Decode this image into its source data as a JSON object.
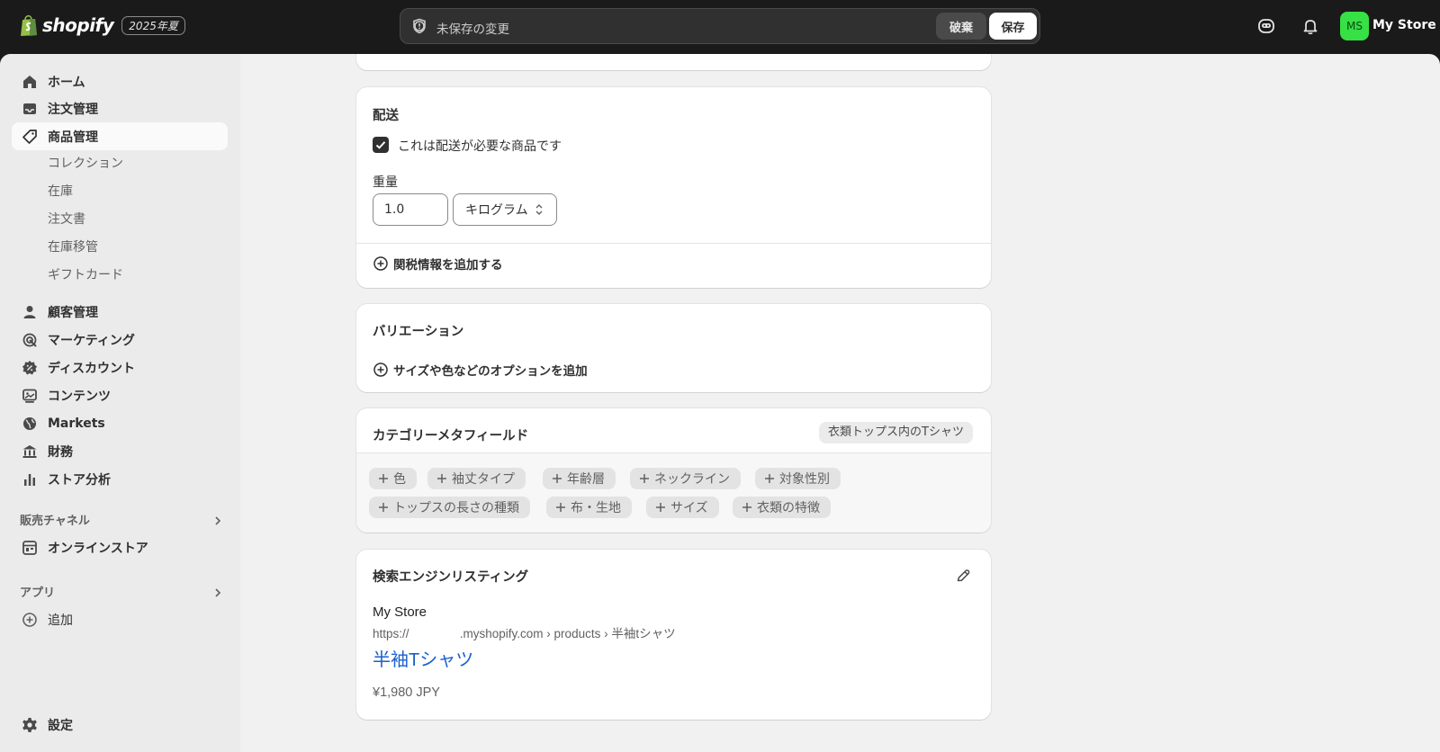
{
  "header": {
    "logo_text": "shopify",
    "edition_badge": "2025年夏",
    "unsaved_text": "未保存の変更",
    "discard_label": "破棄",
    "save_label": "保存",
    "store_initials": "MS",
    "store_name": "My Store",
    "avatar_color": "#36e045"
  },
  "sidebar": {
    "items": [
      {
        "label": "ホーム",
        "icon": "home-icon"
      },
      {
        "label": "注文管理",
        "icon": "inbox-icon"
      },
      {
        "label": "商品管理",
        "icon": "tag-icon",
        "active": true
      }
    ],
    "product_subitems": [
      "コレクション",
      "在庫",
      "注文書",
      "在庫移管",
      "ギフトカード"
    ],
    "items2": [
      {
        "label": "顧客管理",
        "icon": "person-icon"
      },
      {
        "label": "マーケティング",
        "icon": "target-icon"
      },
      {
        "label": "ディスカウント",
        "icon": "discount-icon"
      },
      {
        "label": "コンテンツ",
        "icon": "content-icon"
      },
      {
        "label": "Markets",
        "icon": "globe-icon"
      },
      {
        "label": "財務",
        "icon": "bank-icon"
      },
      {
        "label": "ストア分析",
        "icon": "bar-chart-icon"
      }
    ],
    "sales_channels_title": "販売チャネル",
    "online_store_label": "オンラインストア",
    "apps_title": "アプリ",
    "add_label": "追加",
    "settings_label": "設定"
  },
  "shipping": {
    "title": "配送",
    "requires_shipping_label": "これは配送が必要な商品です",
    "requires_shipping_checked": true,
    "weight_label": "重量",
    "weight_value": "1.0",
    "weight_unit": "キログラム",
    "customs_link": "関税情報を追加する"
  },
  "variants": {
    "title": "バリエーション",
    "add_options_link": "サイズや色などのオプションを追加"
  },
  "metafields": {
    "title": "カテゴリーメタフィールド",
    "category_badge": "衣類トップス内のTシャツ",
    "pills": [
      "色",
      "袖丈タイプ",
      "年齢層",
      "ネックライン",
      "対象性別",
      "トップスの長さの種類",
      "布・生地",
      "サイズ",
      "衣類の特徴"
    ]
  },
  "seo": {
    "title": "検索エンジンリスティング",
    "store_name": "My Store",
    "url": "https://               .myshopify.com › products › 半袖tシャツ",
    "page_title": "半袖Tシャツ",
    "price": "¥1,980 JPY",
    "link_color": "#1a5fd0"
  }
}
